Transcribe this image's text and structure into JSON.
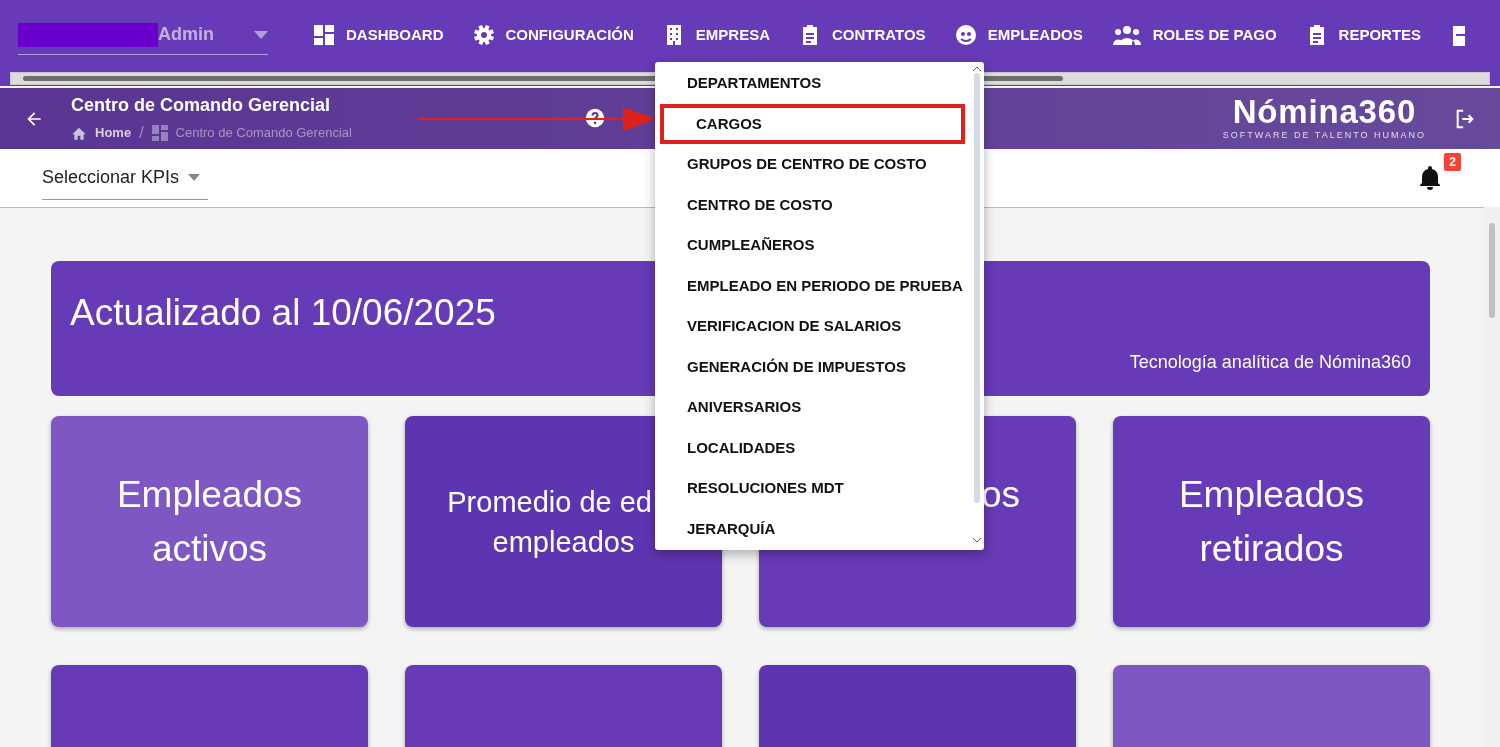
{
  "user": {
    "label": "Admin"
  },
  "nav": [
    {
      "label": "DASHBOARD"
    },
    {
      "label": "CONFIGURACIÓN"
    },
    {
      "label": "EMPRESA"
    },
    {
      "label": "CONTRATOS"
    },
    {
      "label": "EMPLEADOS"
    },
    {
      "label": "ROLES DE PAGO"
    },
    {
      "label": "REPORTES"
    }
  ],
  "header": {
    "title": "Centro de Comando Gerencial",
    "breadcrumb": [
      "Home",
      "Centro de Comando Gerencial"
    ],
    "breadcrumb_separator": "/",
    "logo": "Nómina360",
    "logo_subtitle": "SOFTWARE DE TALENTO HUMANO"
  },
  "kpi_select": {
    "placeholder": "Seleccionar KPIs"
  },
  "notifications": {
    "count": "2"
  },
  "banner": {
    "title": "Actualizado al 10/06/2025",
    "footer": "Tecnología analítica de Nómina360"
  },
  "tiles": [
    {
      "lines": [
        "Empleados",
        "activos"
      ],
      "color": "#7e57c2"
    },
    {
      "lines": [
        "Promedio de ed",
        "empleados"
      ],
      "color": "#5e35b1"
    },
    {
      "lines": [
        "os"
      ],
      "color": "#673ab7"
    },
    {
      "lines": [
        "Empleados",
        "retirados"
      ],
      "color": "#673ab7"
    },
    {
      "color": "#673ab7"
    },
    {
      "color": "#673ab7"
    },
    {
      "color": "#5e35b1"
    },
    {
      "color": "#7e57c2"
    }
  ],
  "dropdown": {
    "items": [
      {
        "label": "DEPARTAMENTOS",
        "selected": false
      },
      {
        "label": "CARGOS",
        "selected": true
      },
      {
        "label": "GRUPOS DE CENTRO DE COSTO",
        "selected": false
      },
      {
        "label": "CENTRO DE COSTO",
        "selected": false
      },
      {
        "label": "CUMPLEAÑEROS",
        "selected": false
      },
      {
        "label": "EMPLEADO EN PERIODO DE PRUEBA",
        "selected": false
      },
      {
        "label": "VERIFICACION DE SALARIOS",
        "selected": false
      },
      {
        "label": "GENERACIÓN DE IMPUESTOS",
        "selected": false
      },
      {
        "label": "ANIVERSARIOS",
        "selected": false
      },
      {
        "label": "LOCALIDADES",
        "selected": false
      },
      {
        "label": "RESOLUCIONES MDT",
        "selected": false
      },
      {
        "label": "JERARQUÍA",
        "selected": false
      }
    ]
  }
}
